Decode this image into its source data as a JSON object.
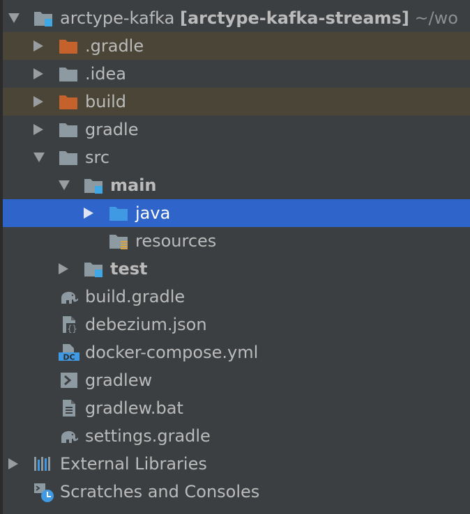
{
  "project": {
    "name": "arctype-kafka",
    "module": "[arctype-kafka-streams]",
    "path": "~/wo"
  },
  "tree": {
    "gradle_dir": ".gradle",
    "idea_dir": ".idea",
    "build_dir": "build",
    "gradle_folder": "gradle",
    "src": "src",
    "main": "main",
    "java": "java",
    "resources": "resources",
    "test": "test",
    "build_gradle": "build.gradle",
    "debezium_json": "debezium.json",
    "docker_compose": "docker-compose.yml",
    "gradlew": "gradlew",
    "gradlew_bat": "gradlew.bat",
    "settings_gradle": "settings.gradle",
    "external_libraries": "External Libraries",
    "scratches": "Scratches and Consoles"
  },
  "colors": {
    "background": "#3c3f41",
    "selection": "#2f65ca",
    "excluded_row": "#4a4536",
    "folder": "#8e9aa1",
    "excluded_folder": "#c5612b",
    "source_folder": "#3f9ae3",
    "module_badge": "#3fa7e3"
  }
}
